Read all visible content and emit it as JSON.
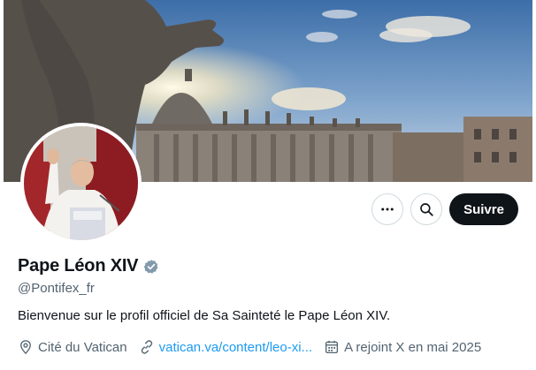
{
  "colors": {
    "text_primary": "#0f1419",
    "text_secondary": "#536471",
    "link": "#1d9bf0",
    "follow_button_bg": "#0f1419",
    "verified_badge": "#829aab"
  },
  "header": {
    "banner_image": "St. Peter's Basilica statue colonnade at sunset",
    "avatar_image": "Pope waving at balcony"
  },
  "actions": {
    "more_icon": "more-horizontal-icon",
    "search_icon": "search-icon",
    "follow_label": "Suivre"
  },
  "profile": {
    "display_name": "Pape Léon XIV",
    "verified_icon": "verified-badge-icon",
    "handle": "@Pontifex_fr",
    "bio": "Bienvenue sur le profil officiel de Sa Sainteté le Pape Léon XIV.",
    "location": "Cité du Vatican",
    "location_icon": "location-pin-icon",
    "website": "vatican.va/content/leo-xi...",
    "website_icon": "link-icon",
    "joined": "A rejoint X en mai 2025",
    "joined_icon": "calendar-icon"
  }
}
